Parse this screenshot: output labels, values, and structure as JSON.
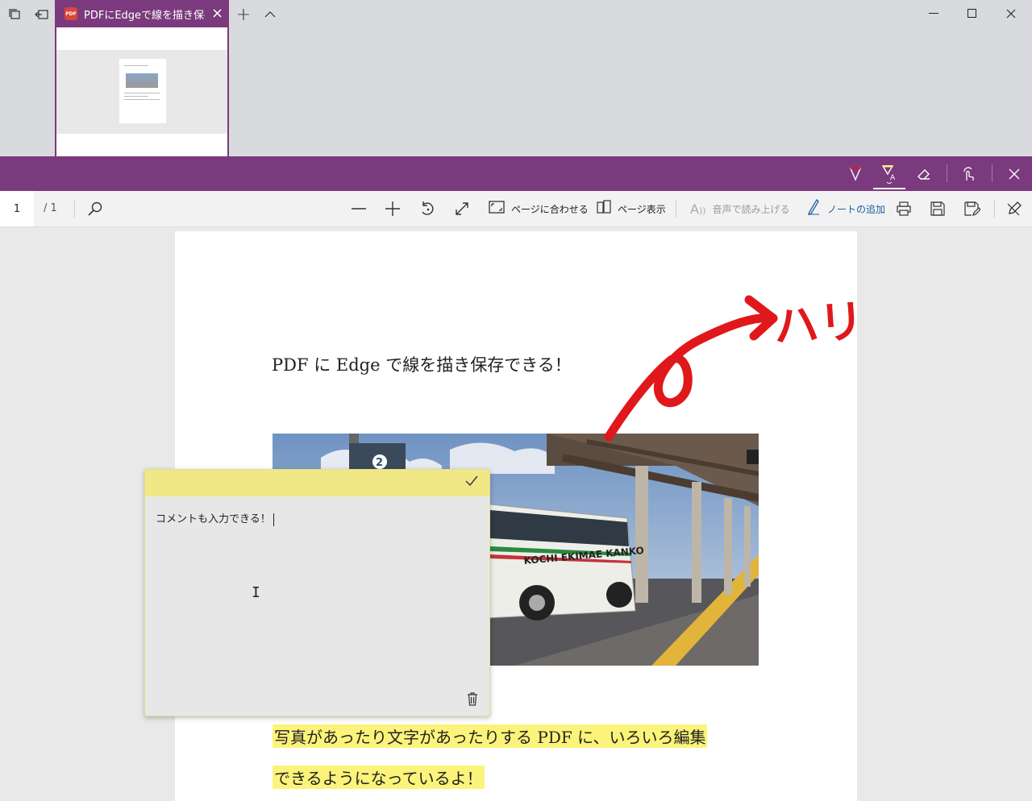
{
  "tab": {
    "title": "PDFにEdgeで線を描き保存",
    "badge": "PDF",
    "close_icon": "×"
  },
  "titlebar": {
    "new_tab": "+",
    "show_tabs": "^",
    "minimize": "—",
    "maximize": "☐",
    "close": "✕"
  },
  "pdf_toolbar": {
    "page_number": "1",
    "page_total": "/ 1",
    "fit_page": "ページに合わせる",
    "page_view": "ページ表示",
    "read_aloud": "音声で読み上げる",
    "add_note": "ノートの追加"
  },
  "document": {
    "title": "PDF に Edge で線を描き保存できる！",
    "paragraph_line1": "写真があったり文字があったりする PDF に、いろいろ編集",
    "paragraph_line2": "できるようになっているよ！",
    "highlight_color": "#fcf37a",
    "ink_color": "#e0181b",
    "ink_text": "ハリ"
  },
  "photo": {
    "bus_text": "KOCHI EKIMAE KANKO",
    "sign_number": "2"
  },
  "note": {
    "text": "コメントも入力できる！",
    "header_color": "#f0e887"
  },
  "theme": {
    "accent": "#7b3a7d",
    "link_blue": "#1d5fa5"
  }
}
